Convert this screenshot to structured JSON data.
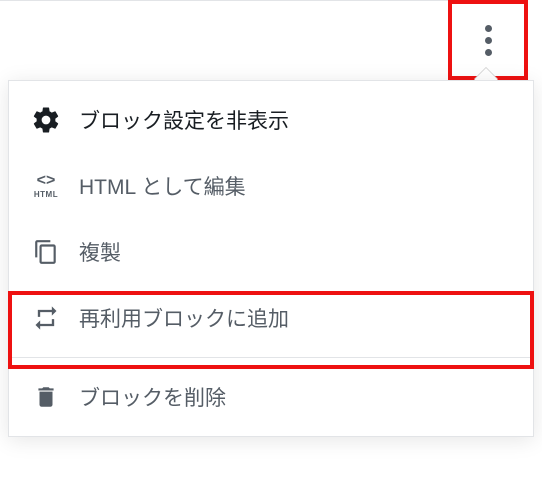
{
  "menu": {
    "hide_settings": "ブロック設定を非表示",
    "edit_as_html": "HTML として編集",
    "html_badge": "HTML",
    "duplicate": "複製",
    "add_reusable": "再利用ブロックに追加",
    "remove_block": "ブロックを削除"
  }
}
